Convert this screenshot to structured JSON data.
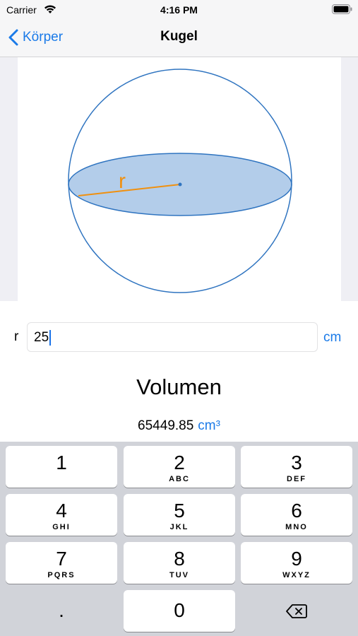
{
  "status_bar": {
    "carrier": "Carrier",
    "time": "4:16 PM"
  },
  "nav": {
    "back_label": "Körper",
    "title": "Kugel"
  },
  "illustration": {
    "radius_label": "r",
    "fill_color": "#b3cdea",
    "stroke_color": "#2f74c0",
    "radius_color": "#f0900f"
  },
  "input": {
    "label": "r",
    "value": "25",
    "unit": "cm"
  },
  "result": {
    "title": "Volumen",
    "value": "65449.85",
    "unit": "cm³"
  },
  "keyboard": {
    "keys": [
      {
        "digit": "1",
        "letters": ""
      },
      {
        "digit": "2",
        "letters": "ABC"
      },
      {
        "digit": "3",
        "letters": "DEF"
      },
      {
        "digit": "4",
        "letters": "GHI"
      },
      {
        "digit": "5",
        "letters": "JKL"
      },
      {
        "digit": "6",
        "letters": "MNO"
      },
      {
        "digit": "7",
        "letters": "PQRS"
      },
      {
        "digit": "8",
        "letters": "TUV"
      },
      {
        "digit": "9",
        "letters": "WXYZ"
      }
    ],
    "decimal": ".",
    "zero": "0",
    "delete_icon": "delete-backspace-icon"
  }
}
